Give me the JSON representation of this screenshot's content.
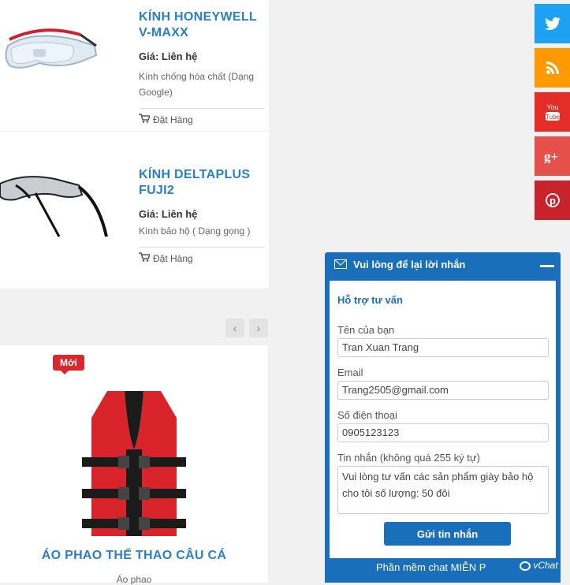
{
  "products": [
    {
      "title": "KÍNH HONEYWELL V-MAXX",
      "price": "Giá: Liên hệ",
      "desc": "Kính chống hóa chất (Dạng Google)",
      "order": "Đặt Hàng",
      "image": "safety-goggles"
    },
    {
      "title": "KÍNH DELTAPLUS FUJI2",
      "price": "Giá: Liên hệ",
      "desc": "Kính bảo hộ ( Dạng gọng )",
      "order": "Đặt Hàng",
      "image": "safety-glasses"
    }
  ],
  "pager": {
    "prev": "‹",
    "next": "›"
  },
  "featured": {
    "badge": "Mới",
    "title": "ÁO PHAO THỂ THAO CÂU CÁ",
    "subtitle": "Áo phao",
    "image": "life-vest"
  },
  "social": [
    {
      "name": "twitter",
      "color": "#1da1f2"
    },
    {
      "name": "rss",
      "color": "#ff9900"
    },
    {
      "name": "youtube",
      "color": "#e52d27"
    },
    {
      "name": "google-plus",
      "color": "#e6504a"
    },
    {
      "name": "pinterest",
      "color": "#c8232c"
    }
  ],
  "chat": {
    "header": "Vui lòng để lại lời nhắn",
    "section_title": "Hỗ trợ tư vấn",
    "name_label": "Tên của bạn",
    "name_value": "Tran Xuan Trang",
    "email_label": "Email",
    "email_value": "Trang2505@gmail.com",
    "phone_label": "Số điện thoại",
    "phone_value": "0905123123",
    "message_label": "Tin nhắn (không quá 255 ký tự)",
    "message_value": "Vui lòng tư vấn các sản phẩm giày bảo hộ cho tôi số lượng: 50 đôi",
    "submit": "Gửi tin nhắn",
    "footer": "Phần mềm chat MIỄN P",
    "brand": "vChat"
  }
}
